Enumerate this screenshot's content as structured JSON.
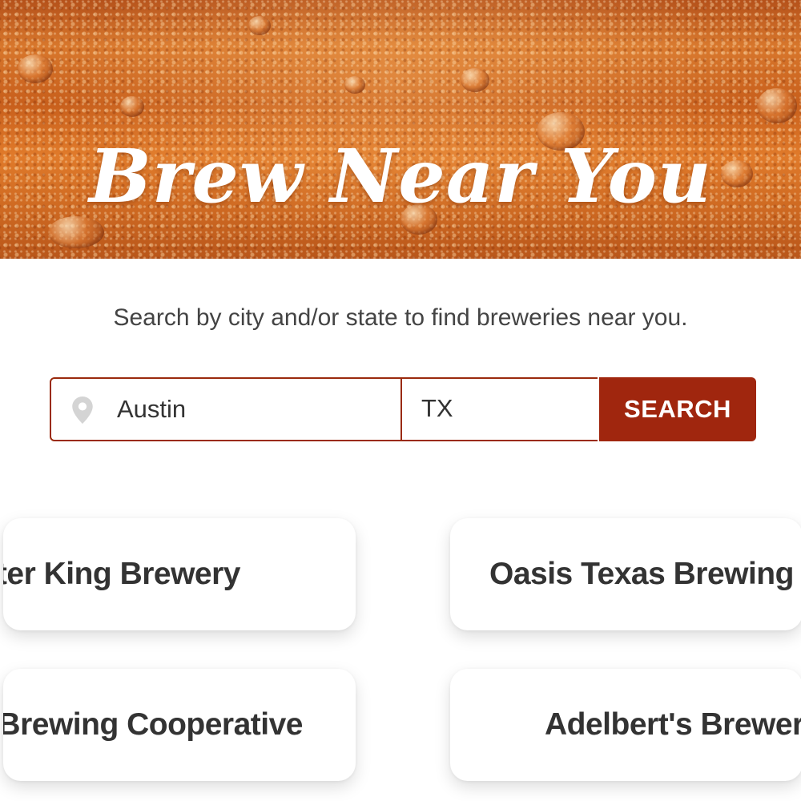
{
  "hero": {
    "title": "Brew Near You"
  },
  "tagline": "Search by city and/or state to find breweries near you.",
  "search": {
    "city_value": "Austin",
    "state_value": "TX",
    "button_label": "SEARCH"
  },
  "results": [
    {
      "name": "Jester King Brewery"
    },
    {
      "name": "Oasis Texas Brewing Company"
    },
    {
      "name": "Black Star Co-op Brewing Cooperative"
    },
    {
      "name": "Adelbert's Brewery"
    }
  ],
  "colors": {
    "accent": "#a0260e",
    "hero_amber": "#d8772c",
    "text": "#333333"
  },
  "icons": {
    "city_field": "map-pin-icon"
  }
}
